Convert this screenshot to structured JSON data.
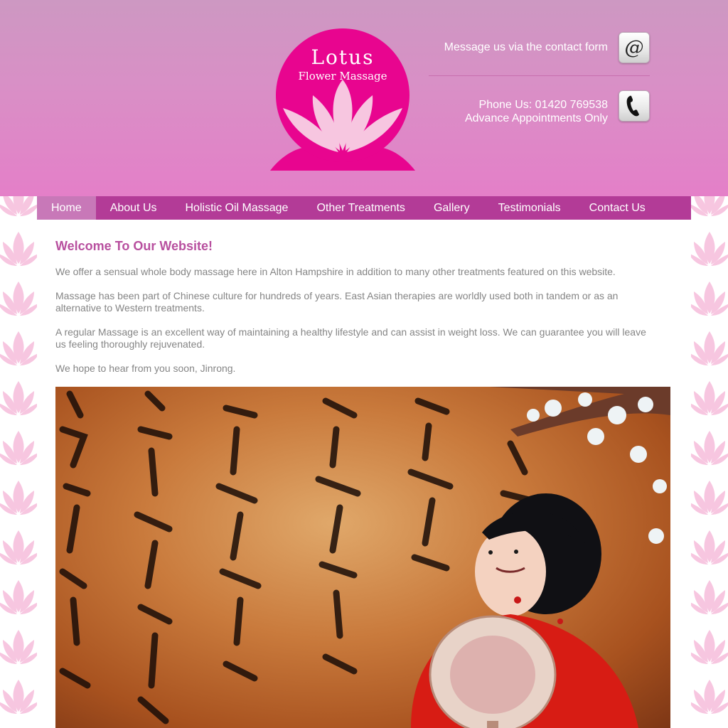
{
  "brand": {
    "logo_line1": "Lotus",
    "logo_line2": "Flower Massage",
    "primary_color": "#e8058f",
    "petal_color": "#f7c6e0"
  },
  "header": {
    "email_text": "Message us via the contact form",
    "email_icon": "at-icon",
    "phone_line": "Phone Us: 01420 769538",
    "appointments_line": "Advance Appointments Only",
    "phone_icon": "phone-icon"
  },
  "nav": {
    "items": [
      {
        "label": "Home"
      },
      {
        "label": "About Us"
      },
      {
        "label": "Holistic Oil Massage"
      },
      {
        "label": "Other Treatments"
      },
      {
        "label": "Gallery"
      },
      {
        "label": "Testimonials"
      },
      {
        "label": "Contact Us"
      }
    ],
    "active": "Home"
  },
  "content": {
    "heading": "Welcome To Our Website!",
    "paragraphs": [
      "We offer a sensual whole body massage here in Alton Hampshire in addition to many other treatments featured on this website.",
      "Massage has been part of Chinese culture for hundreds of years. East Asian therapies are worldly used both in tandem or as an alternative to Western treatments.",
      "A regular Massage is an excellent way of maintaining a healthy lifestyle and can assist in weight loss. We can guarantee you will leave us feeling thoroughly rejuvenated.",
      "We hope to hear from you soon, Jinrong."
    ]
  },
  "colors": {
    "header_top": "#cd98c2",
    "header_bottom": "#e47fc8",
    "nav_bg": "#b33b97",
    "nav_active_bg": "#c878b8",
    "heading": "#b8509f",
    "body_text": "#858585"
  }
}
